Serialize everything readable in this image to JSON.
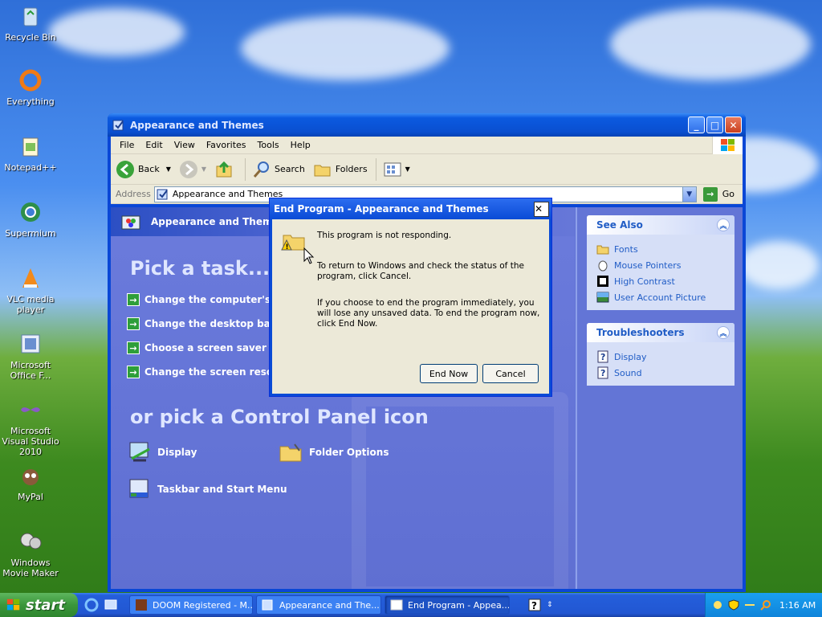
{
  "desktop": {
    "icons": [
      {
        "label": "Recycle Bin",
        "icon": "recycle-bin-icon"
      },
      {
        "label": "Everything",
        "icon": "everything-icon"
      },
      {
        "label": "Notepad++",
        "icon": "notepad-plus-plus-icon"
      },
      {
        "label": "Supermium",
        "icon": "supermium-icon"
      },
      {
        "label": "VLC media player",
        "icon": "vlc-icon"
      },
      {
        "label": "Microsoft Office F...",
        "icon": "office-icon"
      },
      {
        "label": "Microsoft Visual Studio 2010",
        "icon": "visual-studio-icon"
      },
      {
        "label": "MyPal",
        "icon": "mypal-icon"
      },
      {
        "label": "Windows Movie Maker",
        "icon": "movie-maker-icon"
      }
    ]
  },
  "window": {
    "title": "Appearance and Themes",
    "menu": [
      "File",
      "Edit",
      "View",
      "Favorites",
      "Tools",
      "Help"
    ],
    "toolbar": {
      "back": "Back",
      "search": "Search",
      "folders": "Folders"
    },
    "address": {
      "label": "Address",
      "value": "Appearance and Themes",
      "go": "Go"
    },
    "left": {
      "header": "Appearance and Themes",
      "pick_task": "Pick a task...",
      "tasks": [
        "Change the computer's theme",
        "Change the desktop background",
        "Choose a screen saver",
        "Change the screen resolution"
      ],
      "or_pick": "or pick a Control Panel icon",
      "cp_icons": [
        "Display",
        "Folder Options",
        "Taskbar and Start Menu"
      ]
    },
    "right": {
      "see_also": {
        "title": "See Also",
        "links": [
          "Fonts",
          "Mouse Pointers",
          "High Contrast",
          "User Account Picture"
        ]
      },
      "troubleshooters": {
        "title": "Troubleshooters",
        "links": [
          "Display",
          "Sound"
        ]
      }
    }
  },
  "dialog": {
    "title": "End Program - Appearance and Themes",
    "line1": "This program is not responding.",
    "line2": "To return to Windows and check the status of the program, click Cancel.",
    "line3": "If you choose to end the program immediately, you will lose any unsaved data. To end the program now, click End Now.",
    "end_now": "End Now",
    "cancel": "Cancel"
  },
  "taskbar": {
    "start": "start",
    "tasks": [
      "DOOM Registered - M...",
      "Appearance and The...",
      "End Program - Appea..."
    ],
    "clock": "1:16 AM"
  }
}
